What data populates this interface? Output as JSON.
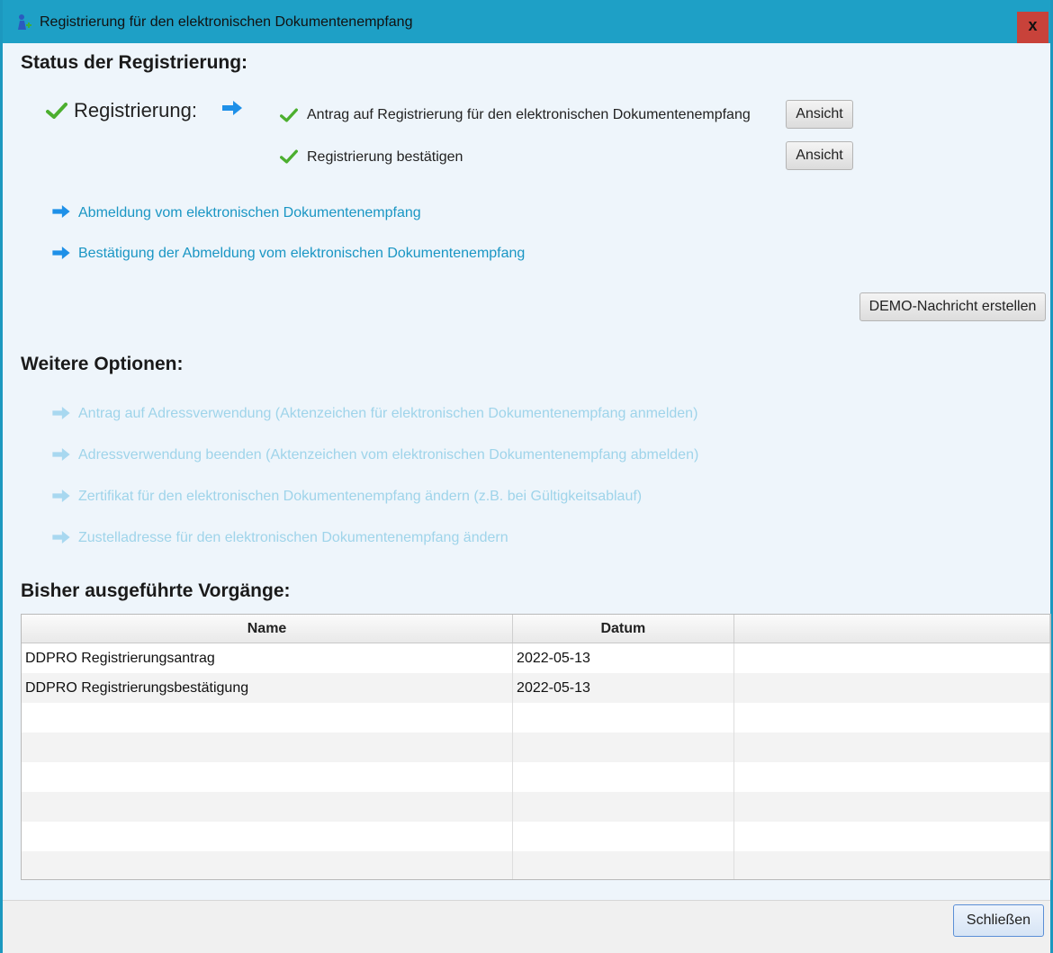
{
  "window": {
    "title": "Registrierung für den elektronischen Dokumentenempfang",
    "close_label": "x"
  },
  "status": {
    "heading": "Status der Registrierung:",
    "registration_label": "Registrierung:",
    "steps": [
      {
        "label": "Antrag auf Registrierung für den elektronischen Dokumentenempfang",
        "button": "Ansicht"
      },
      {
        "label": "Registrierung bestätigen",
        "button": "Ansicht"
      }
    ],
    "links": [
      "Abmeldung vom elektronischen Dokumentenempfang",
      "Bestätigung der Abmeldung vom elektronischen Dokumentenempfang"
    ],
    "demo_button": "DEMO-Nachricht erstellen"
  },
  "options": {
    "heading": "Weitere Optionen:",
    "items": [
      "Antrag auf Adressverwendung (Aktenzeichen für elektronischen Dokumentenempfang anmelden)",
      "Adressverwendung beenden (Aktenzeichen vom elektronischen Dokumentenempfang abmelden)",
      "Zertifikat für den elektronischen Dokumentenempfang ändern (z.B. bei Gültigkeitsablauf)",
      "Zustelladresse für den elektronischen Dokumentenempfang ändern"
    ]
  },
  "history": {
    "heading": "Bisher ausgeführte Vorgänge:",
    "columns": [
      "Name",
      "Datum",
      ""
    ],
    "rows": [
      [
        "DDPRO Registrierungsantrag",
        "2022-05-13",
        ""
      ],
      [
        "DDPRO Registrierungsbestätigung",
        "2022-05-13",
        ""
      ],
      [
        "",
        "",
        ""
      ],
      [
        "",
        "",
        ""
      ],
      [
        "",
        "",
        ""
      ],
      [
        "",
        "",
        ""
      ],
      [
        "",
        "",
        ""
      ],
      [
        "",
        "",
        ""
      ]
    ]
  },
  "footer": {
    "close_button": "Schließen"
  },
  "colors": {
    "titlebar": "#1ea0c6",
    "link": "#1a96c4",
    "disabled_link": "#9fd4ea",
    "check": "#4caf2f",
    "arrow": "#1e90e8"
  }
}
